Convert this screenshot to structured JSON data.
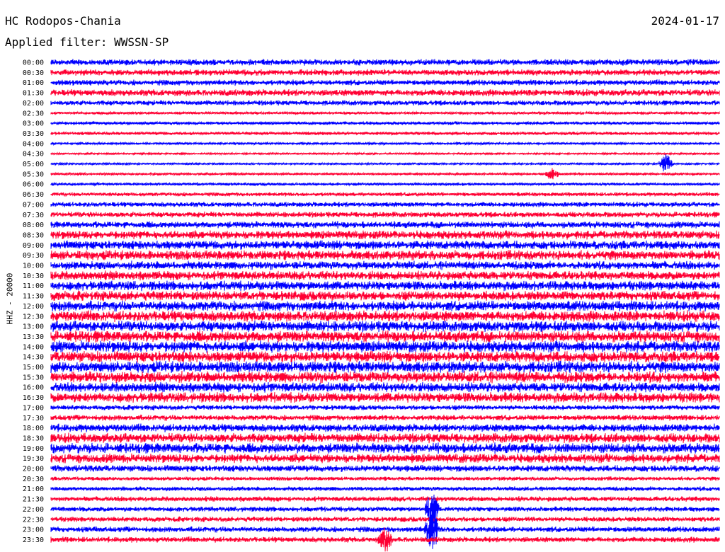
{
  "header": {
    "station": "HC Rodopos-Chania",
    "date": "2024-01-17",
    "filter_label": "Applied filter:",
    "filter_value": "WWSSN-SP"
  },
  "channel_label": "HHZ - 20000",
  "colors": {
    "trace_a": "#0000ff",
    "trace_b": "#ff0033",
    "background": "#ffffff",
    "text": "#000000"
  },
  "chart_data": {
    "type": "line",
    "title": "HC Rodopos-Chania",
    "xlabel": "",
    "ylabel": "HHZ - 20000",
    "y_tick_labels": [
      "00:00",
      "00:30",
      "01:00",
      "01:30",
      "02:00",
      "02:30",
      "03:00",
      "03:30",
      "04:00",
      "04:30",
      "05:00",
      "05:30",
      "06:00",
      "06:30",
      "07:00",
      "07:30",
      "08:00",
      "08:30",
      "09:00",
      "09:30",
      "10:00",
      "10:30",
      "11:00",
      "11:30",
      "12:00",
      "12:30",
      "13:00",
      "13:30",
      "14:00",
      "14:30",
      "15:00",
      "15:30",
      "16:00",
      "16:30",
      "17:00",
      "17:30",
      "18:00",
      "18:30",
      "19:00",
      "19:30",
      "20:00",
      "20:30",
      "21:00",
      "21:30",
      "22:00",
      "22:30",
      "23:00",
      "23:30"
    ],
    "trace_amplitude": [
      0.55,
      0.55,
      0.5,
      0.6,
      0.45,
      0.25,
      0.3,
      0.3,
      0.2,
      0.15,
      0.15,
      0.2,
      0.25,
      0.35,
      0.45,
      0.5,
      0.6,
      0.75,
      0.8,
      0.85,
      0.75,
      0.8,
      0.85,
      0.85,
      0.9,
      0.95,
      0.95,
      1.0,
      1.0,
      1.0,
      1.0,
      1.0,
      0.85,
      0.9,
      0.45,
      0.5,
      0.7,
      0.85,
      0.9,
      0.8,
      0.6,
      0.35,
      0.4,
      0.45,
      0.45,
      0.45,
      0.5,
      0.5
    ],
    "events": [
      {
        "row": "05:00",
        "position": 0.92,
        "amplitude": 2.0
      },
      {
        "row": "05:30",
        "position": 0.75,
        "amplitude": 1.0
      },
      {
        "row": "22:00",
        "position": 0.57,
        "amplitude": 3.0
      },
      {
        "row": "23:00",
        "position": 0.57,
        "amplitude": 4.0
      },
      {
        "row": "23:30",
        "position": 0.5,
        "amplitude": 2.0
      }
    ],
    "grid": false,
    "legend": "none"
  }
}
